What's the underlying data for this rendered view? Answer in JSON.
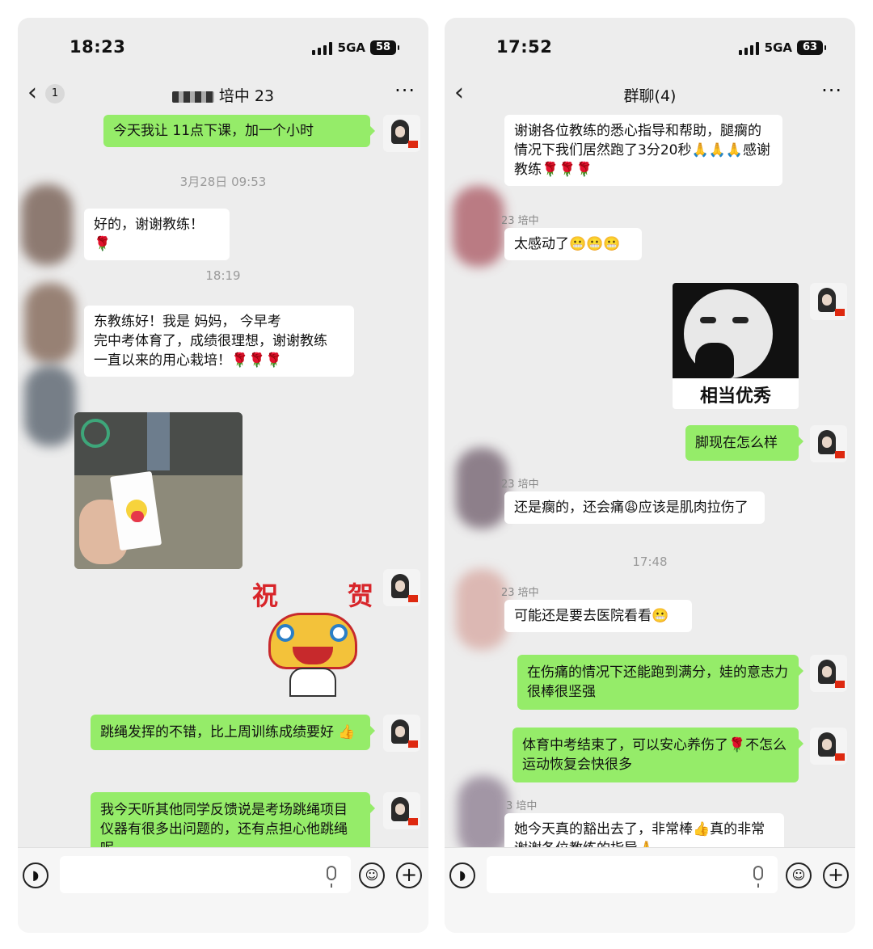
{
  "left": {
    "status": {
      "time": "18:23",
      "network": "5GA",
      "battery": "58"
    },
    "nav": {
      "back_icon": "chevron-left-icon",
      "unread": "1",
      "title": "培中 23",
      "more_icon": "more-icon"
    },
    "messages": {
      "m1": "今天我让 11点下课，加一个小时",
      "t1": "3月28日 09:53",
      "m2": "好的，谢谢教练！🌹",
      "t2": "18:19",
      "m3_line1": "东教练好！我是  妈妈，  今早考",
      "m3_line2": "完中考体育了，成绩很理想，谢谢教练",
      "m3_line3": "一直以来的用心栽培！🌹🌹🌹",
      "sticker_left_char": "祝",
      "sticker_right_char": "贺",
      "m4": "跳绳发挥的不错，比上周训练成绩要好 👍",
      "m5": "我今天听其他同学反馈说是考场跳绳项目仪器有很多出问题的，还有点担心他跳绳呢"
    }
  },
  "right": {
    "status": {
      "time": "17:52",
      "network": "5GA",
      "battery": "63"
    },
    "nav": {
      "back_icon": "chevron-left-icon",
      "title": "群聊(4)",
      "more_icon": "more-icon"
    },
    "messages": {
      "r1": "谢谢各位教练的悉心指导和帮助，腿瘸的情况下我们居然跑了3分20秒🙏🙏🙏感谢教练🌹🌹🌹",
      "s1": "23 培中",
      "r2": "太感动了😬😬😬",
      "meme_caption": "相当优秀",
      "r3": "脚现在怎么样",
      "s2": "23 培中",
      "r4": "还是瘸的，还会痛😩应该是肌肉拉伤了",
      "t1": "17:48",
      "s3": "23 培中",
      "r5": "可能还是要去医院看看😬",
      "r6": "在伤痛的情况下还能跑到满分，娃的意志力很棒很坚强",
      "r7": "体育中考结束了，可以安心养伤了🌹不怎么运动恢复会快很多",
      "s4": "3 培中",
      "r8": "她今天真的豁出去了，非常棒👍真的非常谢谢各位教练的指导🙏"
    }
  },
  "icons": {
    "voice": "voice-icon",
    "mic": "mic-icon",
    "emoji": "emoji-icon",
    "add": "plus-icon"
  },
  "colors": {
    "outgoing_bubble": "#95ec69",
    "incoming_bubble": "#ffffff",
    "chat_bg": "#ededed"
  }
}
